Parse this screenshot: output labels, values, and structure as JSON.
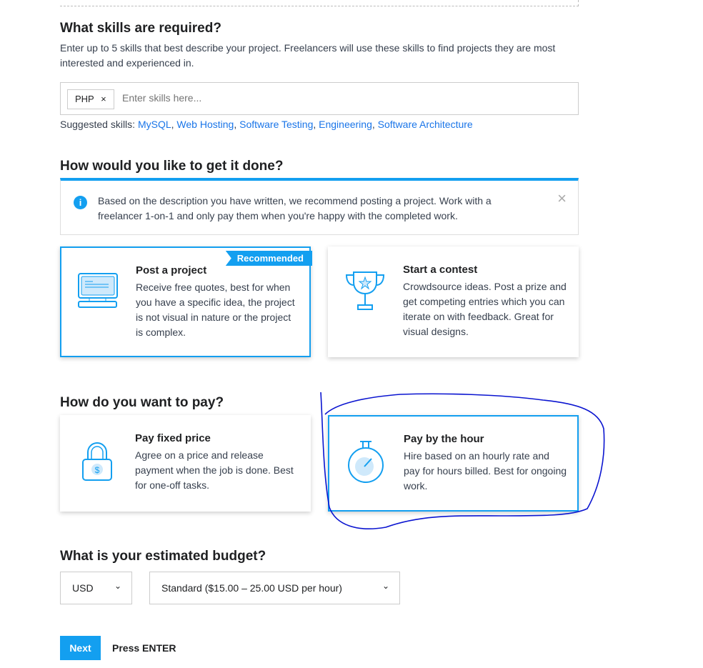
{
  "skills": {
    "title": "What skills are required?",
    "desc": "Enter up to 5 skills that best describe your project. Freelancers will use these skills to find projects they are most interested and experienced in.",
    "tag": "PHP",
    "placeholder": "Enter skills here...",
    "suggested_label": "Suggested skills:",
    "suggested": [
      "MySQL",
      "Web Hosting",
      "Software Testing",
      "Engineering",
      "Software Architecture"
    ]
  },
  "method": {
    "title": "How would you like to get it done?",
    "info": "Based on the description you have written, we recommend posting a project. Work with a freelancer 1-on-1 and only pay them when you're happy with the completed work.",
    "options": [
      {
        "title": "Post a project",
        "desc": "Receive free quotes, best for when you have a specific idea, the project is not visual in nature or the project is complex.",
        "badge": "Recommended",
        "selected": true
      },
      {
        "title": "Start a contest",
        "desc": "Crowdsource ideas. Post a prize and get competing entries which you can iterate on with feedback. Great for visual designs.",
        "selected": false
      }
    ]
  },
  "pay": {
    "title": "How do you want to pay?",
    "options": [
      {
        "title": "Pay fixed price",
        "desc": "Agree on a price and release payment when the job is done. Best for one-off tasks.",
        "selected": false
      },
      {
        "title": "Pay by the hour",
        "desc": "Hire based on an hourly rate and pay for hours billed. Best for ongoing work.",
        "selected": true
      }
    ]
  },
  "budget": {
    "title": "What is your estimated budget?",
    "currency": "USD",
    "range": "Standard ($15.00 – 25.00 USD per hour)"
  },
  "footer": {
    "next": "Next",
    "hint": "Press ENTER"
  },
  "colors": {
    "accent": "#139ff0",
    "link": "#1a75e8",
    "annotation": "#0a14d0"
  }
}
